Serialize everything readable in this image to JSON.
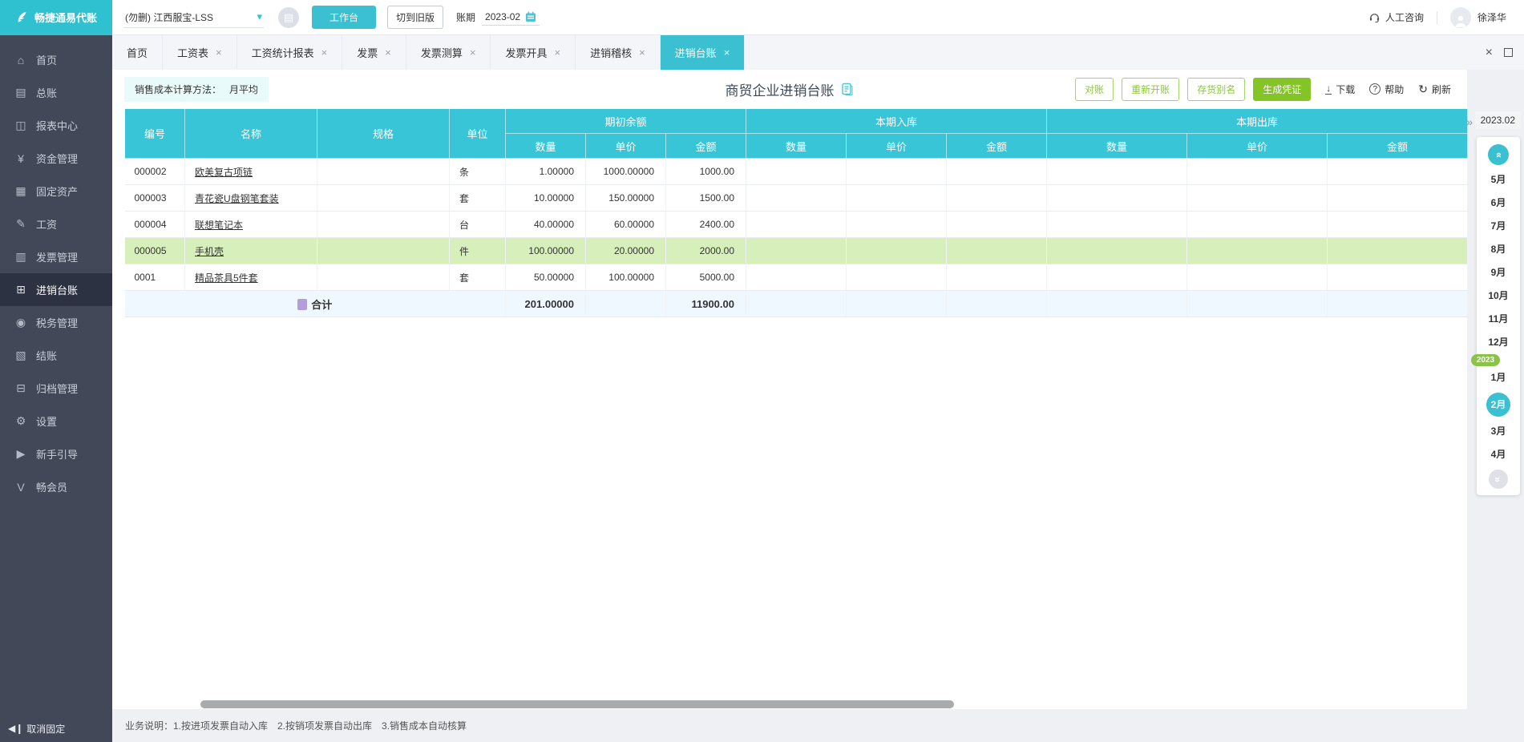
{
  "colors": {
    "accent": "#3ac0d1",
    "header_teal": "#38c5d8",
    "green_solid": "#85c427",
    "green_outline": "#8cc63f",
    "row_highlight": "#d7f0bb",
    "sidebar_bg": "#434859",
    "year_badge": "#8bc34a"
  },
  "topbar": {
    "logo_text": "畅捷通易代账",
    "company": "(勿删) 江西服宝-LSS",
    "workbench": "工作台",
    "switch_old": "切到旧版",
    "period_label": "账期",
    "period_value": "2023-02",
    "support": "人工咨询",
    "username": "徐泽华"
  },
  "icons": {
    "close": "×",
    "chevron_down": "▾",
    "chevron_double": "»",
    "collapse": "»",
    "doc": "▤",
    "download": "↓",
    "help": "?",
    "refresh": "↻",
    "unpin": "◀❙",
    "calc": "▦"
  },
  "sidebar": {
    "items": [
      {
        "label": "首页",
        "icon": "⌂"
      },
      {
        "label": "总账",
        "icon": "▤"
      },
      {
        "label": "报表中心",
        "icon": "◫"
      },
      {
        "label": "资金管理",
        "icon": "¥"
      },
      {
        "label": "固定资产",
        "icon": "▦"
      },
      {
        "label": "工资",
        "icon": "✎"
      },
      {
        "label": "发票管理",
        "icon": "▥"
      },
      {
        "label": "进销台账",
        "icon": "⊞"
      },
      {
        "label": "税务管理",
        "icon": "◉"
      },
      {
        "label": "结账",
        "icon": "▧"
      },
      {
        "label": "归档管理",
        "icon": "⊟"
      },
      {
        "label": "设置",
        "icon": "⚙"
      },
      {
        "label": "新手引导",
        "icon": "▶"
      },
      {
        "label": "畅会员",
        "icon": "V"
      }
    ],
    "unpin": "取消固定"
  },
  "tabbar": {
    "tabs": [
      {
        "label": "首页"
      },
      {
        "label": "工资表"
      },
      {
        "label": "工资统计报表"
      },
      {
        "label": "发票"
      },
      {
        "label": "发票测算"
      },
      {
        "label": "发票开具"
      },
      {
        "label": "进销稽核"
      },
      {
        "label": "进销台账"
      }
    ]
  },
  "toolbar": {
    "method_label": "销售成本计算方法：",
    "method_value": "月平均",
    "title": "商贸企业进销台账",
    "btn_reconcile": "对账",
    "btn_reopen": "重新开账",
    "btn_alias": "存货别名",
    "btn_voucher": "生成凭证",
    "link_download": "下载",
    "link_help": "帮助",
    "link_refresh": "刷新"
  },
  "table": {
    "headers": {
      "code": "编号",
      "name": "名称",
      "spec": "规格",
      "unit": "单位"
    },
    "groups": [
      {
        "label": "期初余额"
      },
      {
        "label": "本期入库"
      },
      {
        "label": "本期出库"
      }
    ],
    "sub": {
      "qty": "数量",
      "price": "单价",
      "amount": "金额"
    },
    "rows": [
      {
        "code": "000002",
        "name": "欧美复古项链",
        "spec": "",
        "unit": "条",
        "qty": "1.00000",
        "price": "1000.00000",
        "amount": "1000.00"
      },
      {
        "code": "000003",
        "name": "青花瓷U盘钢笔套装",
        "spec": "",
        "unit": "套",
        "qty": "10.00000",
        "price": "150.00000",
        "amount": "1500.00"
      },
      {
        "code": "000004",
        "name": "联想笔记本",
        "spec": "",
        "unit": "台",
        "qty": "40.00000",
        "price": "60.00000",
        "amount": "2400.00"
      },
      {
        "code": "000005",
        "name": "手机壳",
        "spec": "",
        "unit": "件",
        "qty": "100.00000",
        "price": "20.00000",
        "amount": "2000.00"
      },
      {
        "code": "0001",
        "name": "精品茶具5件套",
        "spec": "",
        "unit": "套",
        "qty": "50.00000",
        "price": "100.00000",
        "amount": "5000.00"
      }
    ],
    "total": {
      "label": "合计",
      "qty": "201.00000",
      "amount": "11900.00"
    }
  },
  "month_panel": {
    "current": "2023.02",
    "months_top": [
      "5月",
      "6月",
      "7月",
      "8月",
      "9月",
      "10月",
      "11月",
      "12月"
    ],
    "year_badge": "2023",
    "months_bottom": [
      "1月",
      "2月",
      "3月",
      "4月"
    ],
    "active_month": "2月"
  },
  "footer": {
    "note": "业务说明：1.按进项发票自动入库　2.按销项发票自动出库　3.销售成本自动核算"
  }
}
